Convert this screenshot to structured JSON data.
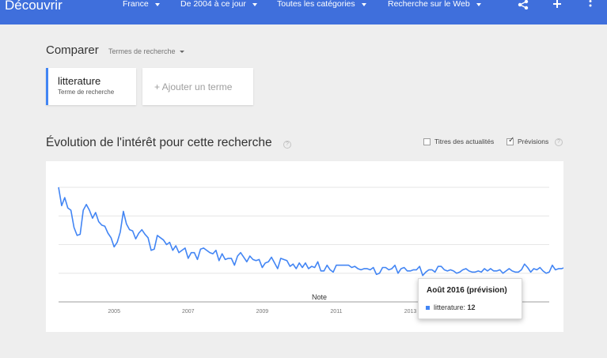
{
  "header": {
    "brand": "Découvrir",
    "filters": {
      "region": "France",
      "period": "De 2004 à ce jour",
      "category": "Toutes les catégories",
      "search_type": "Recherche sur le Web"
    },
    "icons": [
      "share-icon",
      "add-icon",
      "more-vert-icon"
    ],
    "background": "#3f6fdc"
  },
  "compare": {
    "title": "Comparer",
    "type_selector": "Termes de recherche",
    "term": {
      "name": "litterature",
      "type": "Terme de recherche",
      "color": "#4285f4"
    },
    "add_term": "+ Ajouter un terme"
  },
  "interest": {
    "title": "Évolution de l'intérêt pour cette recherche",
    "help": "?",
    "options": [
      {
        "label": "Titres des actualités",
        "checked": false
      },
      {
        "label": "Prévisions",
        "checked": true
      }
    ]
  },
  "chart_data": {
    "type": "line",
    "series": [
      {
        "name": "litterature",
        "color": "#4285f4",
        "values": [
          100,
          84,
          91,
          82,
          80,
          65,
          58,
          59,
          80,
          85,
          80,
          73,
          78,
          70,
          67,
          66,
          60,
          56,
          48,
          52,
          61,
          79,
          68,
          63,
          62,
          55,
          60,
          63,
          59,
          56,
          45,
          46,
          58,
          56,
          54,
          50,
          52,
          45,
          49,
          43,
          45,
          47,
          38,
          43,
          43,
          37,
          46,
          47,
          45,
          43,
          42,
          45,
          36,
          42,
          37,
          38,
          38,
          32,
          40,
          43,
          39,
          35,
          40,
          37,
          36,
          37,
          30,
          34,
          35,
          39,
          34,
          29,
          38,
          37,
          36,
          31,
          33,
          29,
          34,
          30,
          34,
          29,
          31,
          30,
          35,
          27,
          27,
          32,
          28,
          26,
          32,
          32,
          32,
          32,
          32,
          30,
          31,
          29,
          28,
          29,
          29,
          28,
          30,
          24,
          25,
          30,
          30,
          28,
          29,
          32,
          25,
          29,
          30,
          27,
          27,
          28,
          28,
          31,
          23,
          26,
          28,
          28,
          26,
          31,
          31,
          28,
          27,
          28,
          27,
          25,
          26,
          28,
          29,
          27,
          26,
          26,
          27,
          26,
          29,
          27,
          29,
          27,
          27,
          28,
          25,
          27,
          29,
          27,
          26,
          26,
          28,
          33,
          30,
          26,
          29,
          28,
          30,
          27,
          25,
          26,
          32,
          28,
          29,
          29,
          30,
          27,
          27,
          31,
          28,
          33,
          30,
          28,
          29,
          29,
          31,
          27,
          28,
          29,
          27,
          29,
          30,
          28,
          25,
          27,
          29,
          29,
          28,
          30,
          28,
          27,
          26,
          25,
          28
        ]
      }
    ],
    "forecast_values": [
      24,
      30,
      22,
      18,
      23,
      28,
      30,
      27,
      23,
      26,
      24,
      21
    ],
    "x_start_year": 2004,
    "x_end_year": 2017.25,
    "x_ticks": [
      "2005",
      "2007",
      "2009",
      "2011",
      "2013"
    ],
    "ylim": [
      0,
      100
    ],
    "annotation": "Note",
    "tooltip": {
      "title": "Août 2016 (prévision)",
      "series": "litterature",
      "value": "12"
    }
  }
}
